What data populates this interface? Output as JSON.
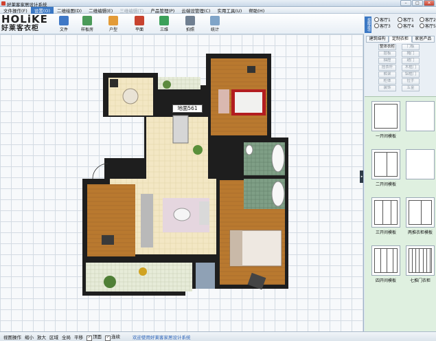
{
  "window": {
    "title": "好莱客家居设计系统",
    "buttons": [
      "–",
      "□",
      "✕"
    ]
  },
  "menu": [
    {
      "label": "文件操作(F)",
      "state": "normal"
    },
    {
      "label": "设置(O)",
      "state": "active"
    },
    {
      "label": "二维绘图(D)",
      "state": "normal"
    },
    {
      "label": "二维编辑(E)",
      "state": "normal"
    },
    {
      "label": "三维编辑(T)",
      "state": "disabled"
    },
    {
      "label": "产品管理(P)",
      "state": "normal"
    },
    {
      "label": "云端设管理(C)",
      "state": "normal"
    },
    {
      "label": "实用工具(U)",
      "state": "normal"
    },
    {
      "label": "帮助(H)",
      "state": "normal"
    }
  ],
  "logo": {
    "en": "HOLiKE",
    "cn": "好莱客衣柜"
  },
  "toolbar": [
    {
      "label": "文件",
      "icon": "file-icon",
      "color": "#3f78c6"
    },
    {
      "label": "样板房",
      "icon": "house-icon",
      "color": "#4a9a58"
    },
    {
      "label": "户型",
      "icon": "floorplan-icon",
      "color": "#e39b37"
    },
    {
      "label": "平面",
      "icon": "plane-view-icon",
      "color": "#c8432f"
    },
    {
      "label": "三维",
      "icon": "3d-view-icon",
      "color": "#3ba05a"
    },
    {
      "label": "拍照",
      "icon": "camera-icon",
      "color": "#6f7f91"
    },
    {
      "label": "统计",
      "icon": "report-icon",
      "color": "#7fa4c8"
    }
  ],
  "right_panel": {
    "view_tag": "视图选项",
    "views": [
      "客厅1",
      "客厅1",
      "客厅2",
      "客厅3",
      "客厅4",
      "客厅5"
    ],
    "tabs": [
      "建筑结构",
      "定制衣柜",
      "家居产品"
    ],
    "active_tab": 1,
    "buttons": [
      {
        "label": "整体衣柜",
        "enabled": true
      },
      {
        "label": "门板",
        "enabled": false
      },
      {
        "label": "层板",
        "enabled": false
      },
      {
        "label": "掩门",
        "enabled": false
      },
      {
        "label": "抽屉",
        "enabled": false
      },
      {
        "label": "趟门",
        "enabled": false
      },
      {
        "label": "挂衣杆",
        "enabled": false
      },
      {
        "label": "木框门",
        "enabled": false
      },
      {
        "label": "裤架",
        "enabled": false
      },
      {
        "label": "铝框门",
        "enabled": false
      },
      {
        "label": "柜体",
        "enabled": false
      },
      {
        "label": "拉手",
        "enabled": false
      },
      {
        "label": "装饰",
        "enabled": false
      },
      {
        "label": "五金",
        "enabled": false
      }
    ],
    "models": [
      {
        "label": "一开间模板",
        "bays": 1
      },
      {
        "label": "",
        "bays": 0
      },
      {
        "label": "二开间模板",
        "bays": 2
      },
      {
        "label": "",
        "bays": 0
      },
      {
        "label": "三开间模板",
        "bays": 3
      },
      {
        "label": "两推衣柜模板",
        "bays": 2
      },
      {
        "label": "四开间模板",
        "bays": 4
      },
      {
        "label": "七推门衣柜",
        "bays": 7
      }
    ]
  },
  "canvas": {
    "area_label": "地面561"
  },
  "statusbar": {
    "items": [
      {
        "label": "视图操作",
        "check": false
      },
      {
        "label": "缩小",
        "check": false
      },
      {
        "label": "放大",
        "check": false
      },
      {
        "label": "区域",
        "check": false
      },
      {
        "label": "全局",
        "check": false
      },
      {
        "label": "平移",
        "check": false
      },
      {
        "label": "顶面",
        "check": true
      },
      {
        "label": "连续",
        "check": true
      }
    ],
    "message": "欢迎使用好莱客家居设计系统"
  }
}
